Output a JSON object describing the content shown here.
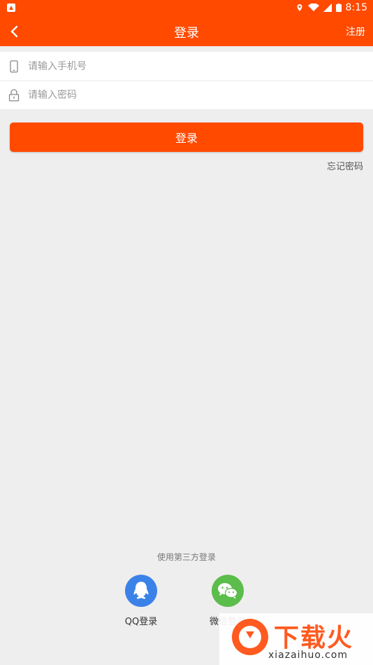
{
  "status_bar": {
    "time": "8:15"
  },
  "app_bar": {
    "title": "登录",
    "register_label": "注册"
  },
  "form": {
    "phone_placeholder": "请输入手机号",
    "password_placeholder": "请输入密码"
  },
  "login_button_label": "登录",
  "forgot_password_label": "忘记密码",
  "third_party": {
    "label": "使用第三方登录",
    "qq_label": "QQ登录",
    "wechat_label": "微信登录"
  },
  "watermark": {
    "brand": "下载火",
    "domain": "xiazaihuo.com"
  },
  "colors": {
    "accent": "#ff4a00",
    "qq": "#3b82e8",
    "wechat": "#5bbd4a"
  }
}
